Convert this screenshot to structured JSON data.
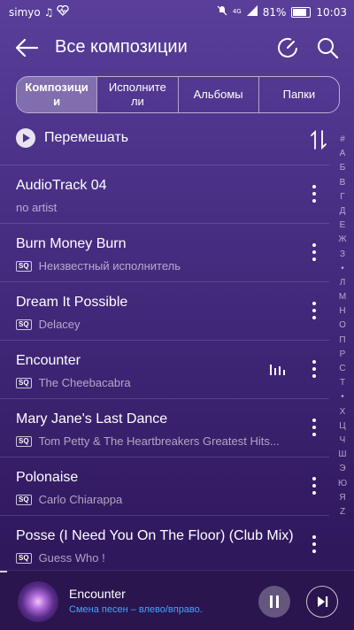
{
  "status_bar": {
    "carrier": "simyo",
    "left_icons": [
      "music-note-icon",
      "heart-monitor-icon"
    ],
    "network": "4G",
    "battery": "81%",
    "battery_level": 0.81,
    "time": "10:03"
  },
  "header": {
    "title": "Все композиции",
    "icons": [
      "back-arrow-icon",
      "sleep-timer-icon",
      "search-icon"
    ]
  },
  "tabs": [
    {
      "label": "Композици\nи",
      "active": true
    },
    {
      "label": "Исполните\nли",
      "active": false
    },
    {
      "label": "Альбомы",
      "active": false
    },
    {
      "label": "Папки",
      "active": false
    }
  ],
  "shuffle": {
    "label": "Перемешать"
  },
  "songs": [
    {
      "title": "AudioTrack 04",
      "artist": "no artist",
      "sq": false,
      "playing": false
    },
    {
      "title": "Burn Money Burn",
      "artist": "Неизвестный исполнитель",
      "sq": true,
      "playing": false
    },
    {
      "title": "Dream It Possible",
      "artist": "Delacey",
      "sq": true,
      "playing": false
    },
    {
      "title": "Encounter",
      "artist": "The Cheebacabra",
      "sq": true,
      "playing": true
    },
    {
      "title": "Mary Jane's Last Dance",
      "artist": "Tom Petty & The Heartbreakers Greatest Hits...",
      "sq": true,
      "playing": false
    },
    {
      "title": "Polonaise",
      "artist": "Carlo Chiarappa",
      "sq": true,
      "playing": false
    },
    {
      "title": "Posse (I Need You On The Floor) (Club Mix)",
      "artist": "Guess Who !",
      "sq": true,
      "playing": false
    }
  ],
  "sq_badge": "SQ",
  "alphabet_index": [
    "#",
    "А",
    "Б",
    "В",
    "Г",
    "Д",
    "Е",
    "Ж",
    "З",
    "•",
    "Л",
    "М",
    "Н",
    "О",
    "П",
    "Р",
    "С",
    "Т",
    "•",
    "Х",
    "Ц",
    "Ч",
    "Ш",
    "Э",
    "Ю",
    "Я",
    "Z"
  ],
  "now_playing": {
    "title": "Encounter",
    "hint": "Смена песен – влево/вправо.",
    "progress": 0.02,
    "hint_color": "#42a5ff"
  }
}
